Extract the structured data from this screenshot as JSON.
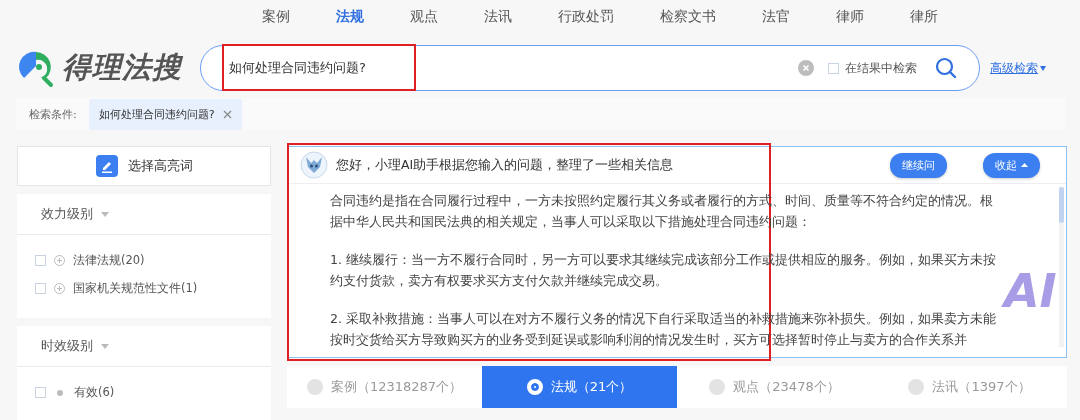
{
  "nav": {
    "items": [
      {
        "label": "案例",
        "selected": false
      },
      {
        "label": "法规",
        "selected": true
      },
      {
        "label": "观点",
        "selected": false
      },
      {
        "label": "法讯",
        "selected": false
      },
      {
        "label": "行政处罚",
        "selected": false
      },
      {
        "label": "检察文书",
        "selected": false
      },
      {
        "label": "法官",
        "selected": false
      },
      {
        "label": "律师",
        "selected": false
      },
      {
        "label": "律所",
        "selected": false
      }
    ]
  },
  "logo": {
    "text": "得理法搜"
  },
  "search": {
    "value": "如何处理合同违约问题?",
    "within_results": {
      "label": "在结果中检索",
      "checked": false
    },
    "advanced": "高级检索"
  },
  "conditions": {
    "label": "检索条件:",
    "tags": [
      "如何处理合同违约问题?"
    ]
  },
  "sidebar": {
    "highlight_button": "选择高亮词",
    "sections": [
      {
        "title": "效力级别",
        "items": [
          {
            "kind": "expandable",
            "label": "法律法规(20)",
            "checked": false
          },
          {
            "kind": "expandable",
            "label": "国家机关规范性文件(1)",
            "checked": false
          }
        ]
      },
      {
        "title": "时效级别",
        "items": [
          {
            "kind": "dot",
            "label": "有效(6)",
            "checked": false
          }
        ]
      }
    ]
  },
  "ai_panel": {
    "greeting": "您好，小理AI助手根据您输入的问题，整理了一些相关信息",
    "buttons": [
      "继续问",
      "收起"
    ],
    "badge": "AI",
    "paragraphs": [
      "合同违约是指在合同履行过程中，一方未按照约定履行其义务或者履行的方式、时间、质量等不符合约定的情况。根据中华人民共和国民法典的相关规定，当事人可以采取以下措施处理合同违约问题：",
      "1. 继续履行：当一方不履行合同时，另一方可以要求其继续完成该部分工作或提供相应的服务。例如，如果买方未按约支付货款，卖方有权要求买方支付欠款并继续完成交易。",
      "2. 采取补救措施：当事人可以在对方不履行义务的情况下自行采取适当的补救措施来弥补损失。例如，如果卖方未能按时交货给买方导致购买方的业务受到延误或影响利润的情况发生时，买方可选择暂时停止与卖方的合作关系并"
    ]
  },
  "result_tabs": [
    {
      "label": "案例（12318287个）",
      "selected": false
    },
    {
      "label": "法规（21个）",
      "selected": true
    },
    {
      "label": "观点（23478个）",
      "selected": false
    },
    {
      "label": "法讯（1397个）",
      "selected": false
    }
  ]
}
